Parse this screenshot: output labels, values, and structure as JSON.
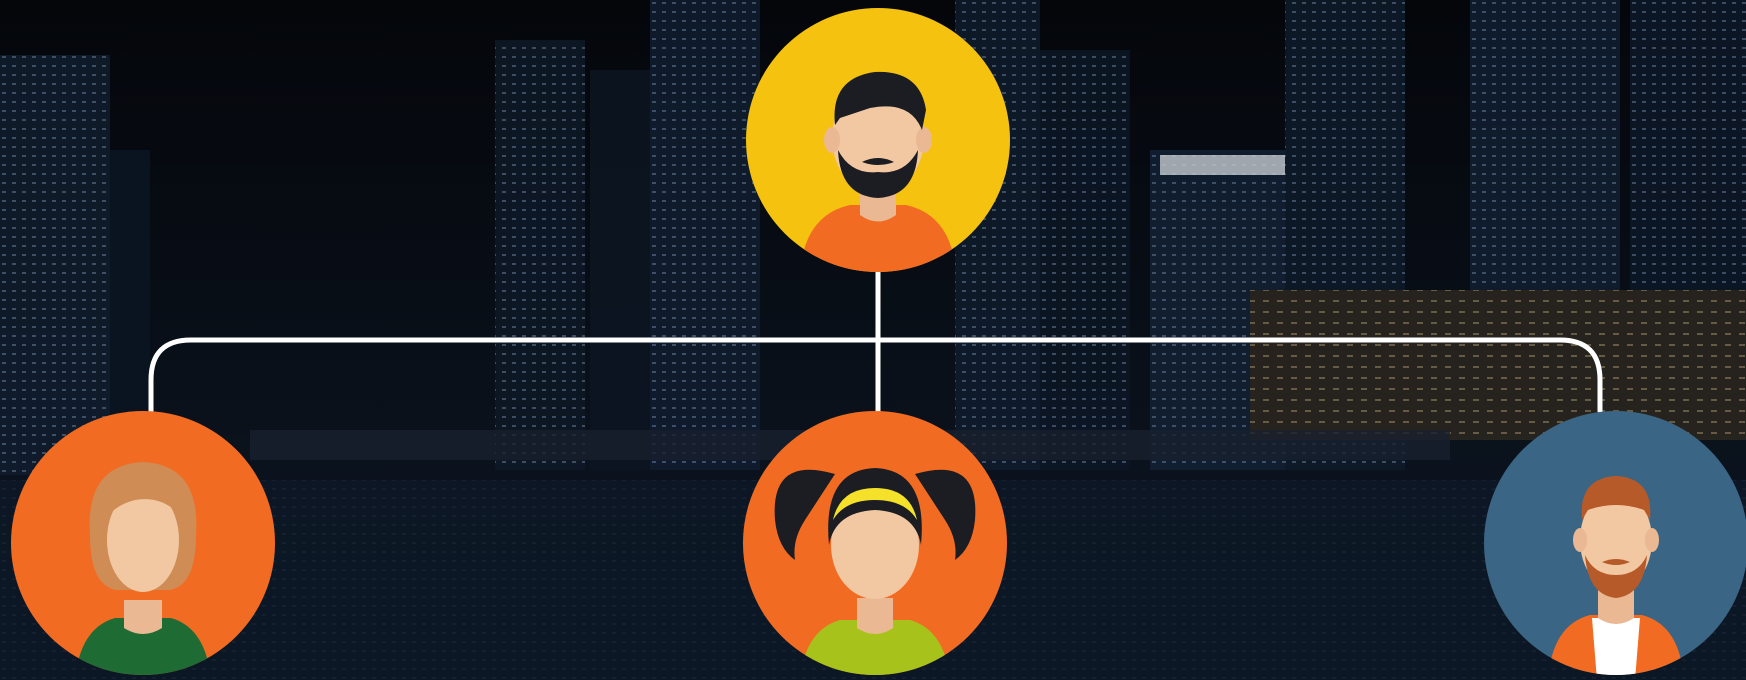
{
  "colors": {
    "background_top": "#04060a",
    "background_bottom": "#0b1420",
    "connector": "#ffffff",
    "yellow": "#f5c210",
    "orange": "#f26b22",
    "blue": "#3b6584",
    "skin": "#f2c8a2",
    "hair_dark": "#1b1d22",
    "hair_red": "#b65a2a",
    "hair_blonde": "#d08c55"
  },
  "nodes": [
    {
      "id": "top",
      "avatar": "bearded-man-icon",
      "bg": "yellow"
    },
    {
      "id": "left",
      "avatar": "woman-icon",
      "bg": "orange"
    },
    {
      "id": "middle",
      "avatar": "girl-pigtails-icon",
      "bg": "orange"
    },
    {
      "id": "right",
      "avatar": "red-haired-man-icon",
      "bg": "blue"
    }
  ],
  "edges": [
    {
      "from": "top",
      "to": "left"
    },
    {
      "from": "top",
      "to": "middle"
    },
    {
      "from": "top",
      "to": "right"
    }
  ]
}
